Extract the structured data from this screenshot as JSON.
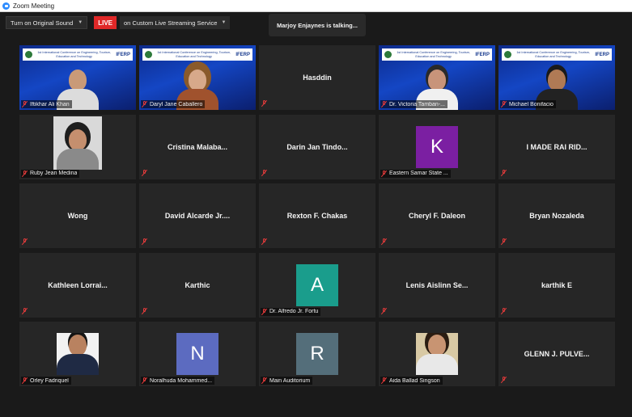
{
  "window": {
    "title": "Zoom Meeting"
  },
  "toolbar": {
    "original_sound": "Turn on Original Sound",
    "live_badge": "LIVE",
    "live_destination": "on Custom Live Streaming Service"
  },
  "talking_indicator": "Marjoy Enjaynes is talking...",
  "colors": {
    "live": "#e02828",
    "mute": "#e53b3b",
    "tile": "#262626"
  },
  "participants": [
    {
      "name": "Iftikhar Ali Khan",
      "kind": "video"
    },
    {
      "name": "Daryl Jane Caballero",
      "kind": "video"
    },
    {
      "name": "Hasddin",
      "kind": "name"
    },
    {
      "name": "Dr. Victoria Tamban-...",
      "kind": "video"
    },
    {
      "name": "Michael Bonifacio",
      "kind": "video"
    },
    {
      "name": "Ruby Jean Medina",
      "kind": "photo"
    },
    {
      "name": "Cristina  Malaba...",
      "kind": "name"
    },
    {
      "name": "Darin Jan Tindo...",
      "kind": "name"
    },
    {
      "name": "Eastern Samar State ...",
      "kind": "avatar",
      "letter": "K",
      "color": "#7b1fa2"
    },
    {
      "name": "I MADE RAI RID...",
      "kind": "name"
    },
    {
      "name": "Wong",
      "kind": "name"
    },
    {
      "name": "David Alcarde Jr....",
      "kind": "name"
    },
    {
      "name": "Rexton F. Chakas",
      "kind": "name"
    },
    {
      "name": "Cheryl F. Daleon",
      "kind": "name"
    },
    {
      "name": "Bryan Nozaleda",
      "kind": "name"
    },
    {
      "name": "Kathleen  Lorrai...",
      "kind": "name"
    },
    {
      "name": "Karthic",
      "kind": "name"
    },
    {
      "name": "Dr. Alfredo Jr. Fortu",
      "kind": "avatar",
      "letter": "A",
      "color": "#1a9d8c"
    },
    {
      "name": "Lenis Aislinn Se...",
      "kind": "name"
    },
    {
      "name": "karthik E",
      "kind": "name"
    },
    {
      "name": "Orley Fadriquel",
      "kind": "photo"
    },
    {
      "name": "Noralhuda Mohammed...",
      "kind": "avatar",
      "letter": "N",
      "color": "#5c6bc0"
    },
    {
      "name": "Main Auditorium",
      "kind": "avatar",
      "letter": "R",
      "color": "#546e7a"
    },
    {
      "name": "Aida Ballad Singson",
      "kind": "photo"
    },
    {
      "name": "GLENN J. PULVE...",
      "kind": "name"
    }
  ],
  "banner": {
    "text": "1st International Conference on Engineering, Tourism, Education and Technology",
    "brand": "IFERP"
  }
}
